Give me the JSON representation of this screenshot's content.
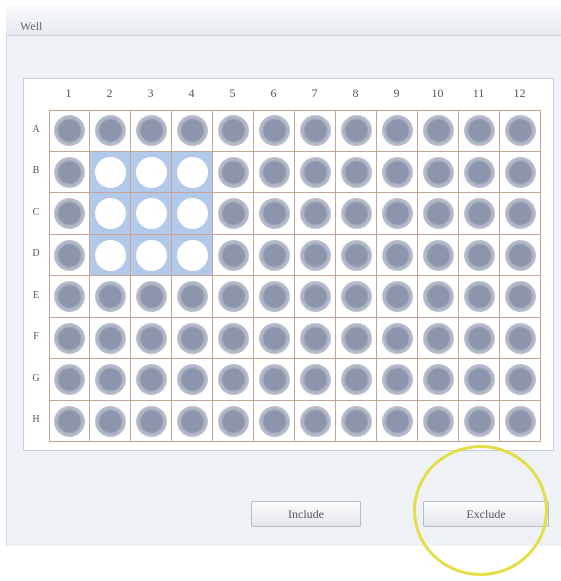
{
  "tab": {
    "label": "Well"
  },
  "plate": {
    "columns": [
      "1",
      "2",
      "3",
      "4",
      "5",
      "6",
      "7",
      "8",
      "9",
      "10",
      "11",
      "12"
    ],
    "rows": [
      "A",
      "B",
      "C",
      "D",
      "E",
      "F",
      "G",
      "H"
    ],
    "selected_wells": [
      "B2",
      "B3",
      "B4",
      "C2",
      "C3",
      "C4",
      "D2",
      "D3",
      "D4"
    ]
  },
  "buttons": {
    "include_label": "Include",
    "exclude_label": "Exclude"
  },
  "colors": {
    "well_fill": "#8c95ab",
    "selection_highlight": "#b3c9e9",
    "grid_line": "#c6a598",
    "annotation_circle": "#e2de44"
  },
  "icons": {
    "annotation": "highlight-circle"
  }
}
